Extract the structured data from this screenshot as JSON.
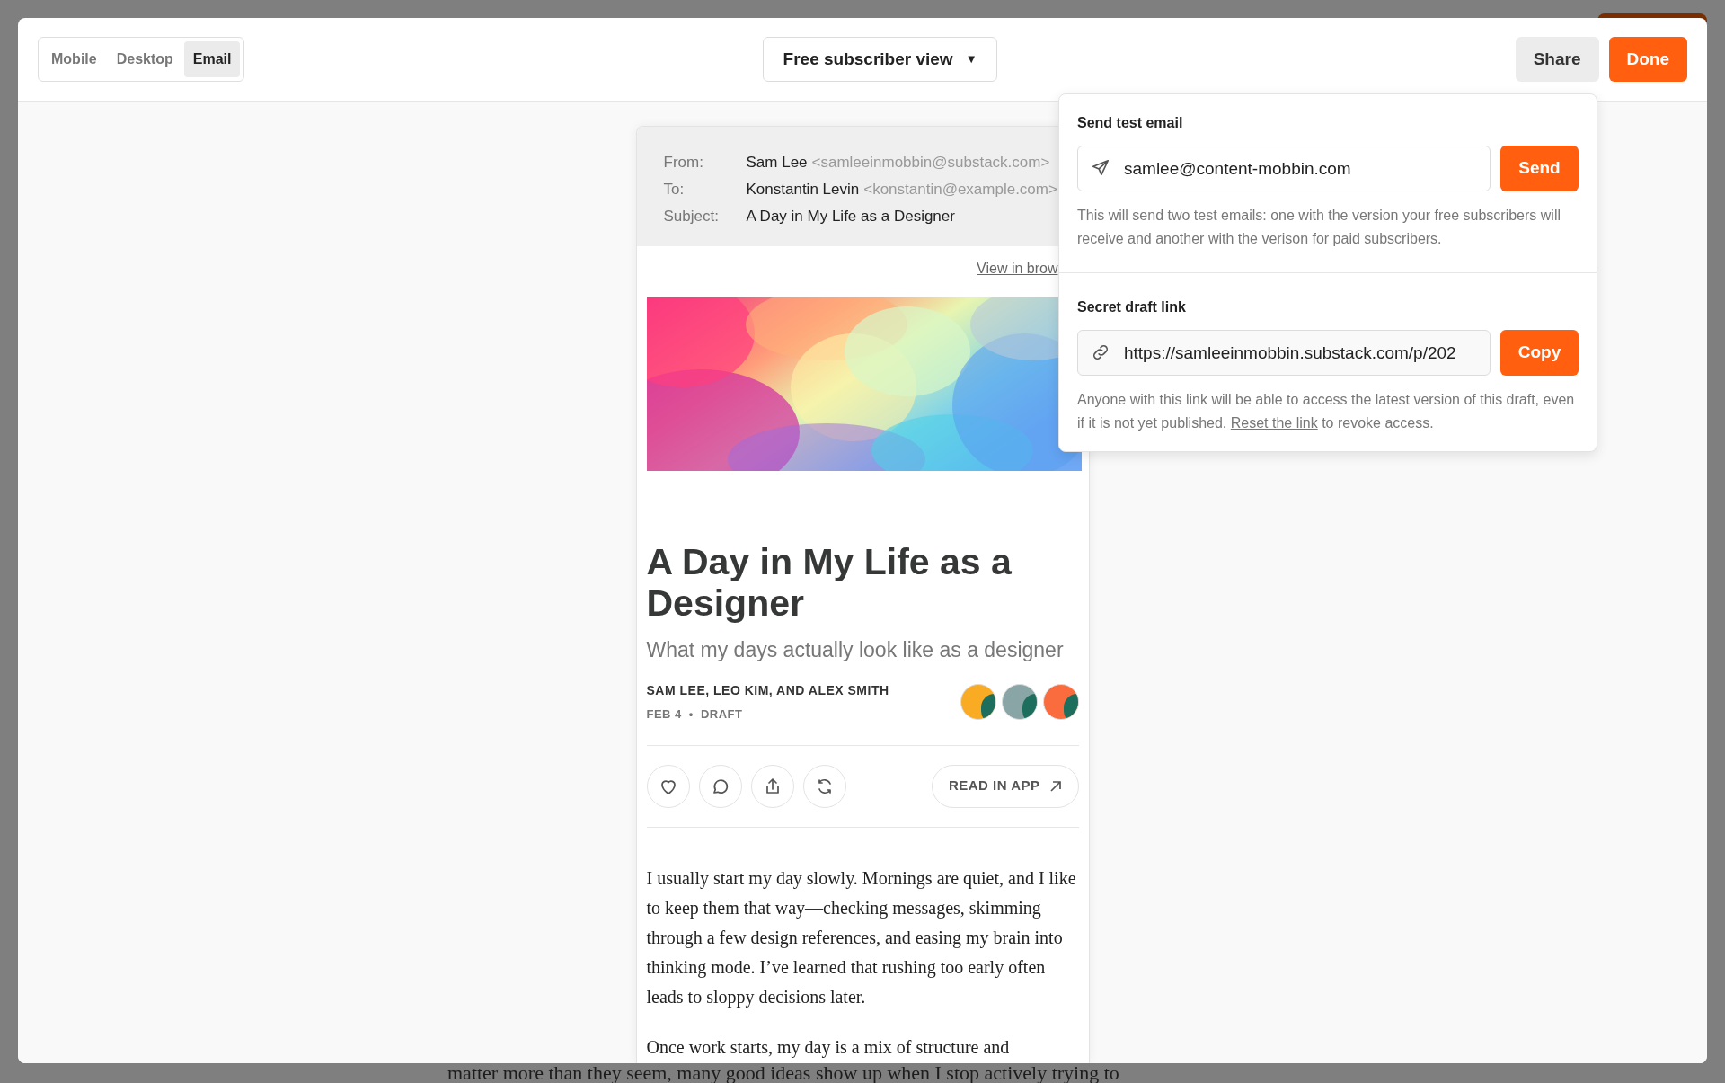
{
  "toolbar": {
    "view_tabs": [
      {
        "label": "Mobile",
        "selected": false
      },
      {
        "label": "Desktop",
        "selected": false
      },
      {
        "label": "Email",
        "selected": true
      }
    ],
    "audience_dropdown": {
      "label": "Free subscriber view",
      "caret": "▼"
    },
    "buttons": [
      {
        "label": "Share",
        "kind": "secondary"
      },
      {
        "label": "Done",
        "kind": "primary"
      }
    ]
  },
  "email": {
    "headers": [
      {
        "label": "From:",
        "name": "Sam Lee",
        "address": "<samleeinmobbin@substack.com>"
      },
      {
        "label": "To:",
        "name": "Konstantin Levin",
        "address": "<konstantin@example.com>"
      },
      {
        "label": "Subject:",
        "name": "A Day in My Life as a Designer"
      }
    ],
    "view_in_browser": "View in brow",
    "hero": {
      "kind": "picture"
    },
    "title": "A Day in My Life as a Designer",
    "subtitle": "What my days actually look like as a designer",
    "authors": "SAM LEE, LEO KIM, AND ALEX SMITH",
    "date": "FEB 4",
    "separator": "•",
    "status": "DRAFT",
    "avatars": [
      {
        "color": "#f9ab24"
      },
      {
        "color": "#8aa5a6"
      },
      {
        "color": "#fa6b3d"
      }
    ],
    "actions": [
      {
        "kind": "like"
      },
      {
        "kind": "comment"
      },
      {
        "kind": "share"
      },
      {
        "kind": "restack"
      }
    ],
    "read_in_app": "READ IN APP",
    "paragraphs": [
      "I usually start my day slowly. Mornings are quiet, and I like to keep them that way—checking messages, skimming through a few design references, and easing my brain into thinking mode. I’ve learned that rushing too early often leads to sloppy decisions later.",
      "Once work starts, my day is a mix of structure and"
    ]
  },
  "popover": {
    "test_email": {
      "heading": "Send test email",
      "value": "samlee@content-mobbin.com",
      "button": "Send",
      "note": "This will send two test emails: one with the version your free subscribers will receive and another with the verison for paid subscribers."
    },
    "draft_link": {
      "heading": "Secret draft link",
      "value": "https://samleeinmobbin.substack.com/p/202",
      "button": "Copy",
      "note_before": "Anyone with this link will be able to access the latest version of this draft, even if it is not yet published. ",
      "note_link": "Reset the link",
      "note_after": " to revoke access."
    }
  },
  "background_text": "matter more than they seem, many good ideas show up when I stop actively trying to"
}
